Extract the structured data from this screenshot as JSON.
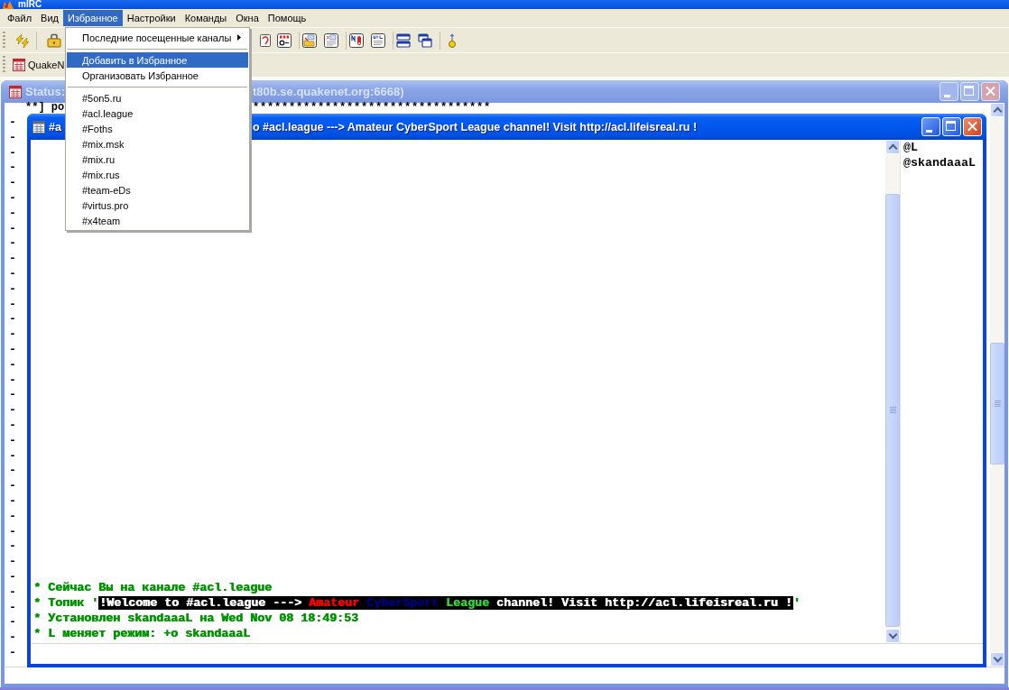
{
  "window": {
    "title": "mIRC"
  },
  "menu_bar": [
    {
      "label": "Файл",
      "selected": false
    },
    {
      "label": "Вид",
      "selected": false
    },
    {
      "label": "Избранное",
      "selected": true
    },
    {
      "label": "Настройки",
      "selected": false
    },
    {
      "label": "Команды",
      "selected": false
    },
    {
      "label": "Окна",
      "selected": false
    },
    {
      "label": "Помощь",
      "selected": false
    }
  ],
  "switchbar": [
    {
      "label": "QuakeN"
    }
  ],
  "status_window": {
    "active": false,
    "title_start": "Status:",
    "title_end": "t80b.se.quakenet.org:6668)",
    "first_line_start": "**] ро",
    "first_line_end": "*********************************",
    "lines": [
      "-",
      "-",
      "-",
      "-",
      "-",
      "-",
      "-",
      "-",
      "-",
      "-",
      "-",
      "-",
      "-",
      "-",
      "-",
      "-",
      "-",
      "-",
      "-",
      "-",
      "-",
      "-",
      "-",
      "-",
      "-",
      "-",
      "-",
      "-",
      "-",
      "-",
      "-",
      "-",
      "-",
      "-",
      "-",
      "-"
    ]
  },
  "channel_window": {
    "active": true,
    "title_start": "#a",
    "title_end": "o #acl.league ---> Amateur CyberSport League channel! Visit http://acl.lifeisreal.ru !",
    "messages": [
      {
        "kind": "event",
        "text": "* Сейчас Вы на канале #acl.league"
      },
      {
        "kind": "topic",
        "prefix": "* Топик '",
        "segments": [
          {
            "text": "!Welcome to #acl.league ---> ",
            "kind": "white"
          },
          {
            "text": "Amateur ",
            "kind": "red"
          },
          {
            "text": "CyberSport ",
            "kind": "navy"
          },
          {
            "text": "League ",
            "kind": "lime"
          },
          {
            "text": "channel! Visit http://acl.lifeisreal.ru !",
            "kind": "white"
          }
        ],
        "suffix": "'"
      },
      {
        "kind": "event",
        "text": "* Установлен skandaaaL на Wed Nov 08 18:49:53"
      },
      {
        "kind": "event",
        "text": "* L меняет режим: +o skandaaaL"
      }
    ],
    "nicklist": [
      "@L",
      "@skandaaaL"
    ]
  },
  "dropdown_menu": [
    {
      "kind": "submenu",
      "label": "Последние посещенные каналы",
      "selected": false
    },
    {
      "kind": "separator"
    },
    {
      "kind": "item",
      "label": "Добавить в Избранное",
      "selected": true
    },
    {
      "kind": "item",
      "label": "Организовать Избранное",
      "selected": false
    },
    {
      "kind": "separator"
    },
    {
      "kind": "item",
      "label": "#5on5.ru",
      "selected": false
    },
    {
      "kind": "item",
      "label": "#acl.league",
      "selected": false
    },
    {
      "kind": "item",
      "label": "#Foths",
      "selected": false
    },
    {
      "kind": "item",
      "label": "#mix.msk",
      "selected": false
    },
    {
      "kind": "item",
      "label": "#mix.ru",
      "selected": false
    },
    {
      "kind": "item",
      "label": "#mix.rus",
      "selected": false
    },
    {
      "kind": "item",
      "label": "#team-eDs",
      "selected": false
    },
    {
      "kind": "item",
      "label": "#virtus.pro",
      "selected": false
    },
    {
      "kind": "item",
      "label": "#x4team",
      "selected": false
    }
  ]
}
